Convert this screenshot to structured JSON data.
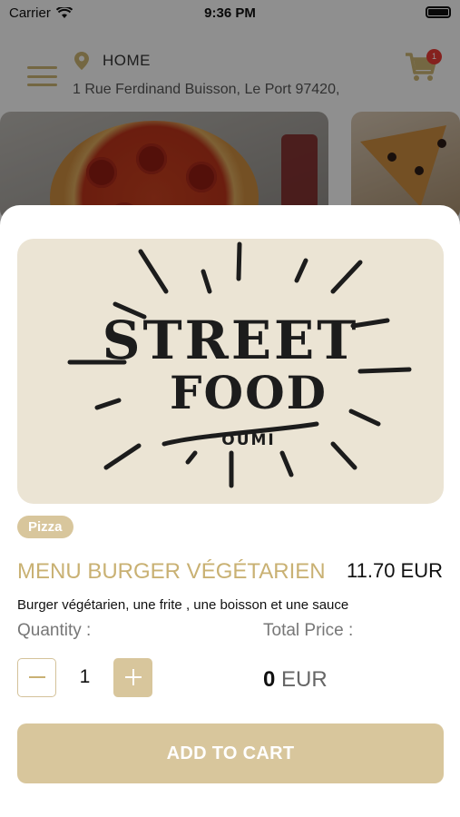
{
  "status_bar": {
    "carrier": "Carrier",
    "time": "9:36 PM"
  },
  "header": {
    "location_label": "HOME",
    "address": "1 Rue Ferdinand Buisson, Le Port 97420,",
    "cart_count": "1"
  },
  "brand_logo": {
    "line1": "STREET",
    "line2": "FOOD",
    "line3": "OUMI"
  },
  "product": {
    "category": "Pizza",
    "name": "MENU BURGER VÉGÉTARIEN",
    "price": "11.70 EUR",
    "description": "Burger végétarien,  une frite , une boisson et une sauce"
  },
  "quantity": {
    "label": "Quantity :",
    "value": "1"
  },
  "total": {
    "label": "Total Price :",
    "amount": "0",
    "currency": "EUR"
  },
  "actions": {
    "add_to_cart": "ADD TO CART"
  },
  "colors": {
    "accent": "#c9b173",
    "accent_fill": "#d8c69c",
    "badge": "#e53935"
  },
  "icons": [
    "wifi-icon",
    "battery-icon",
    "menu-icon",
    "location-pin-icon",
    "cart-icon",
    "minus-icon",
    "plus-icon"
  ]
}
